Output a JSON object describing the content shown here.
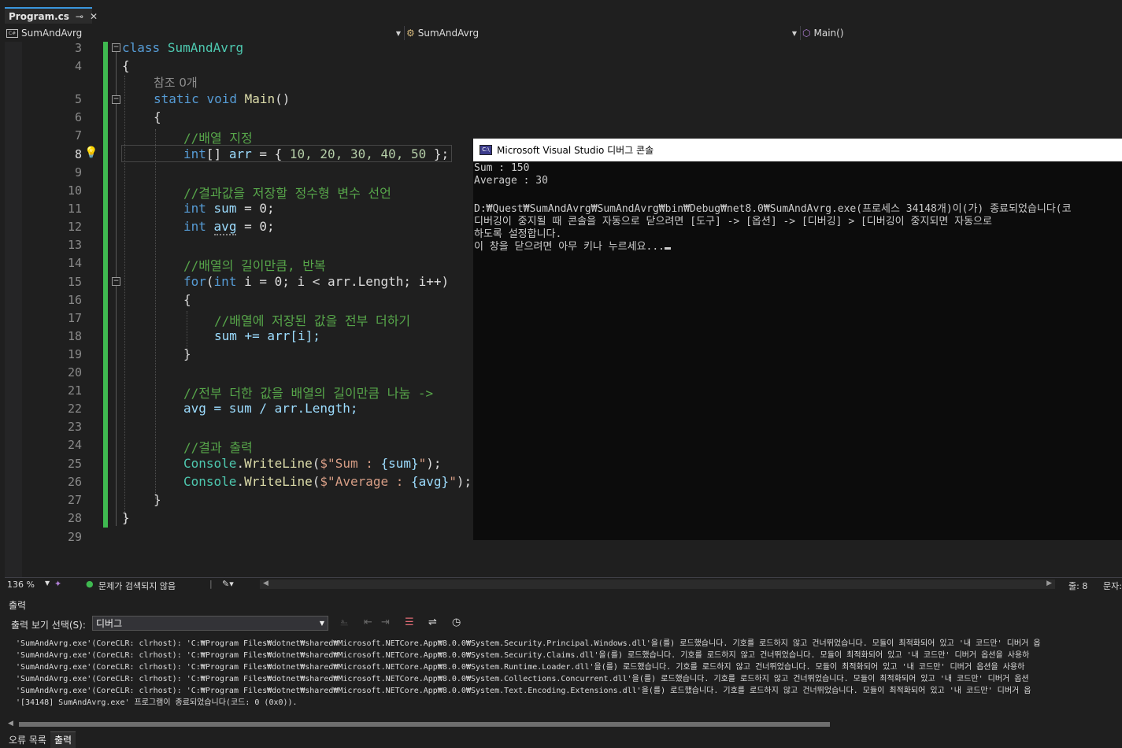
{
  "tab": {
    "title": "Program.cs",
    "pin": "⊸",
    "close": "✕"
  },
  "nav": {
    "project": "SumAndAvrg",
    "class": "SumAndAvrg",
    "member": "Main()"
  },
  "editor": {
    "line_numbers": [
      "3",
      "4",
      "",
      "5",
      "6",
      "7",
      "8",
      "9",
      "10",
      "11",
      "12",
      "13",
      "14",
      "15",
      "16",
      "17",
      "18",
      "19",
      "20",
      "21",
      "22",
      "23",
      "24",
      "25",
      "26",
      "27",
      "28",
      "29"
    ],
    "ref_hint": "참조 0개",
    "zoom": "136 %",
    "issues": "문제가 검색되지 않음",
    "line_status": "줄: 8",
    "col_status": "문자:"
  },
  "code": {
    "l3_kw": "class",
    "l3_cls": "SumAndAvrg",
    "l4": "{",
    "l5_static": "static",
    "l5_void": "void",
    "l5_main": "Main",
    "l5_rest": "()",
    "l6": "{",
    "l7": "//배열 지정",
    "l8_int": "int",
    "l8_a": "[] ",
    "l8_arr": "arr",
    "l8_eq": " = { ",
    "l8_vals": "10, 20, 30, 40, 50",
    "l8_end": " };",
    "l10": "//결과값을 저장할 정수형 변수 선언",
    "l11_int": "int",
    "l11_id": "sum",
    "l11_rest": " = 0;",
    "l12_int": "int",
    "l12_id": "avg",
    "l12_rest": " = 0;",
    "l14": "//배열의 길이만큼, 반복",
    "l15_for": "for",
    "l15_a": "(",
    "l15_int": "int",
    "l15_b": " i = 0; i < arr.Length; i++)",
    "l16": "{",
    "l17": "//배열에 저장된 값을 전부 더하기",
    "l18": "sum += arr[i];",
    "l19": "}",
    "l21": "//전부 더한 값을 배열의 길이만큼 나눔 ->",
    "l22": "avg = sum / arr.Length;",
    "l24": "//결과 출력",
    "l25_cls": "Console",
    "l25_dot": ".",
    "l25_m": "WriteLine",
    "l25_a": "(",
    "l25_s1": "$\"Sum : ",
    "l25_v": "{sum}",
    "l25_s2": "\"",
    "l25_e": ");",
    "l26_cls": "Console",
    "l26_dot": ".",
    "l26_m": "WriteLine",
    "l26_a": "(",
    "l26_s1": "$\"Average : ",
    "l26_v": "{avg}",
    "l26_s2": "\"",
    "l26_e": ");",
    "l27": "}",
    "l28": "}"
  },
  "console": {
    "title": "Microsoft Visual Studio 디버그 콘솔",
    "icon_text": "C:\\",
    "lines": [
      "Sum : 150",
      "Average : 30",
      "",
      "D:₩Quest₩SumAndAvrg₩SumAndAvrg₩bin₩Debug₩net8.0₩SumAndAvrg.exe(프로세스 34148개)이(가) 종료되었습니다(코",
      "디버깅이 중지될 때 콘솔을 자동으로 닫으려면 [도구] -> [옵션] -> [디버깅] > [디버깅이 중지되면 자동으로",
      "하도록 설정합니다.",
      "이 창을 닫으려면 아무 키나 누르세요..."
    ]
  },
  "output": {
    "header": "출력",
    "source_label": "출력 보기 선택(S):",
    "source_value": "디버그",
    "lines": [
      "'SumAndAvrg.exe'(CoreCLR: clrhost): 'C:₩Program Files₩dotnet₩shared₩Microsoft.NETCore.App₩8.0.0₩System.Security.Principal.Windows.dll'을(를) 로드했습니다. 기호를 로드하지 않고 건너뛰었습니다. 모듈이 최적화되어 있고 '내 코드만' 디버거 옵",
      "'SumAndAvrg.exe'(CoreCLR: clrhost): 'C:₩Program Files₩dotnet₩shared₩Microsoft.NETCore.App₩8.0.0₩System.Security.Claims.dll'을(를) 로드했습니다. 기호를 로드하지 않고 건너뛰었습니다. 모듈이 최적화되어 있고 '내 코드만' 디버거 옵션을 사용하",
      "'SumAndAvrg.exe'(CoreCLR: clrhost): 'C:₩Program Files₩dotnet₩shared₩Microsoft.NETCore.App₩8.0.0₩System.Runtime.Loader.dll'을(를) 로드했습니다. 기호를 로드하지 않고 건너뛰었습니다. 모듈이 최적화되어 있고 '내 코드만' 디버거 옵션을 사용하",
      "'SumAndAvrg.exe'(CoreCLR: clrhost): 'C:₩Program Files₩dotnet₩shared₩Microsoft.NETCore.App₩8.0.0₩System.Collections.Concurrent.dll'을(를) 로드했습니다. 기호를 로드하지 않고 건너뛰었습니다. 모듈이 최적화되어 있고 '내 코드만' 디버거 옵션",
      "'SumAndAvrg.exe'(CoreCLR: clrhost): 'C:₩Program Files₩dotnet₩shared₩Microsoft.NETCore.App₩8.0.0₩System.Text.Encoding.Extensions.dll'을(를) 로드했습니다. 기호를 로드하지 않고 건너뛰었습니다. 모듈이 최적화되어 있고 '내 코드만' 디버거 옵",
      "'[34148] SumAndAvrg.exe' 프로그램이 종료되었습니다(코드: 0 (0x0))."
    ]
  },
  "bottom_tabs": [
    "오류 목록",
    "출력"
  ],
  "colors": {
    "keyword": "#569cd6",
    "type": "#4ec9b0",
    "comment": "#57a64a",
    "change_bar": "#3fb950"
  }
}
